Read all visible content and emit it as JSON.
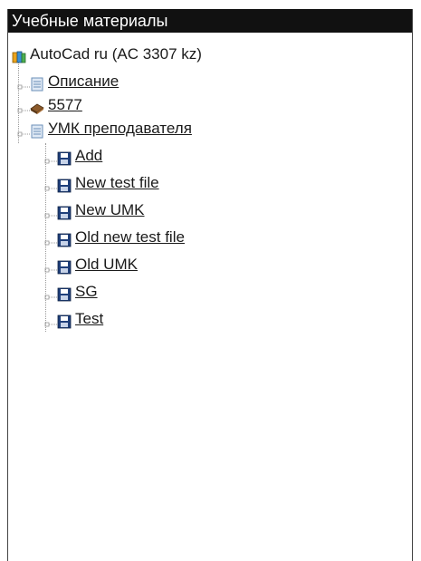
{
  "panel": {
    "title": "Учебные материалы"
  },
  "tree": {
    "root": {
      "label": "AutoCad ru (AC 3307 kz)",
      "icon": "books-icon"
    },
    "children": [
      {
        "label": "Описание",
        "icon": "document-icon"
      },
      {
        "label": "5577",
        "icon": "book-icon"
      },
      {
        "label": "УМК преподавателя",
        "icon": "document-icon"
      }
    ],
    "umk_children": [
      {
        "label": "Add",
        "icon": "save-icon"
      },
      {
        "label": "New test file",
        "icon": "save-icon"
      },
      {
        "label": "New UMK",
        "icon": "save-icon"
      },
      {
        "label": "Old new test file",
        "icon": "save-icon"
      },
      {
        "label": "Old UMK",
        "icon": "save-icon"
      },
      {
        "label": "SG",
        "icon": "save-icon"
      },
      {
        "label": "Test",
        "icon": "save-icon"
      }
    ]
  }
}
